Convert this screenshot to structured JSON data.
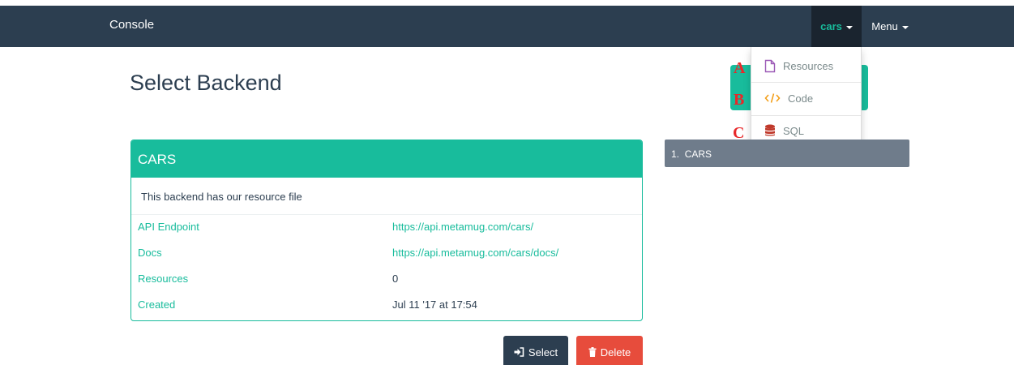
{
  "navbar": {
    "brand": "Console",
    "backend_menu": "cars",
    "main_menu": "Menu"
  },
  "page": {
    "title": "Select Backend"
  },
  "annotations": [
    "A",
    "B",
    "C"
  ],
  "dropdown": {
    "items": [
      {
        "label": "Resources",
        "icon": "file-icon",
        "color": "#9b59b6"
      },
      {
        "label": "Code",
        "icon": "code-icon",
        "color": "#f39c12"
      },
      {
        "label": "SQL",
        "icon": "database-icon",
        "color": "#c0392b"
      }
    ]
  },
  "panel": {
    "title": "CARS",
    "description": "This backend has our resource file",
    "rows": [
      {
        "key": "API Endpoint",
        "value": "https://api.metamug.com/cars/"
      },
      {
        "key": "Docs",
        "value": "https://api.metamug.com/cars/docs/"
      },
      {
        "key": "Resources",
        "value": "0"
      },
      {
        "key": "Created",
        "value": "Jul 11 '17 at 17:54"
      }
    ]
  },
  "backend_list": {
    "items": [
      {
        "index": "1.",
        "name": "CARS"
      }
    ]
  },
  "actions": {
    "select_label": "Select",
    "delete_label": "Delete"
  },
  "colors": {
    "navbar": "#2c3e50",
    "accent": "#18bc9c",
    "danger": "#e74c3c",
    "list_item": "#6f7c8b"
  }
}
